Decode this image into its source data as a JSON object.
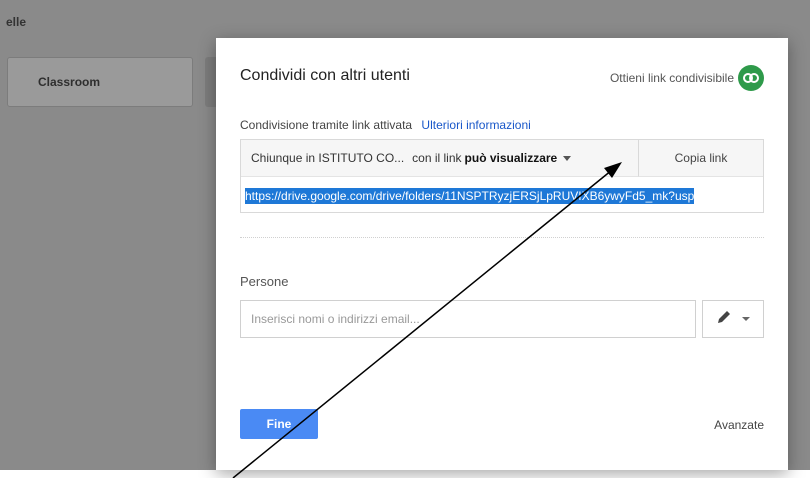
{
  "background": {
    "partial_label": "elle",
    "card_label": "Classroom"
  },
  "dialog": {
    "title": "Condividi con altri utenti",
    "get_link_label": "Ottieni link condivisibile",
    "link_sharing_status": "Condivisione tramite link attivata",
    "learn_more": "Ulteriori informazioni",
    "permission": {
      "audience": "Chiunque in ISTITUTO CO...",
      "with_link": "con il link",
      "access": "può visualizzare"
    },
    "copy_link": "Copia link",
    "share_url": "https://drive.google.com/drive/folders/11NSPTRyzjERSjLpRUVIXB6ywyFd5_mk?usp",
    "people_label": "Persone",
    "people_placeholder": "Inserisci nomi o indirizzi email...",
    "done_button": "Fine",
    "advanced": "Avanzate"
  },
  "colors": {
    "backdrop": "#8a8a8a",
    "done_button": "#4a8af4",
    "link_badge": "#2e9a4a",
    "url_highlight": "#1e78d7",
    "learn_more_link": "#1a58c9"
  },
  "icons": [
    "link-icon",
    "dropdown-caret-icon",
    "pencil-icon",
    "annotation-arrow"
  ]
}
